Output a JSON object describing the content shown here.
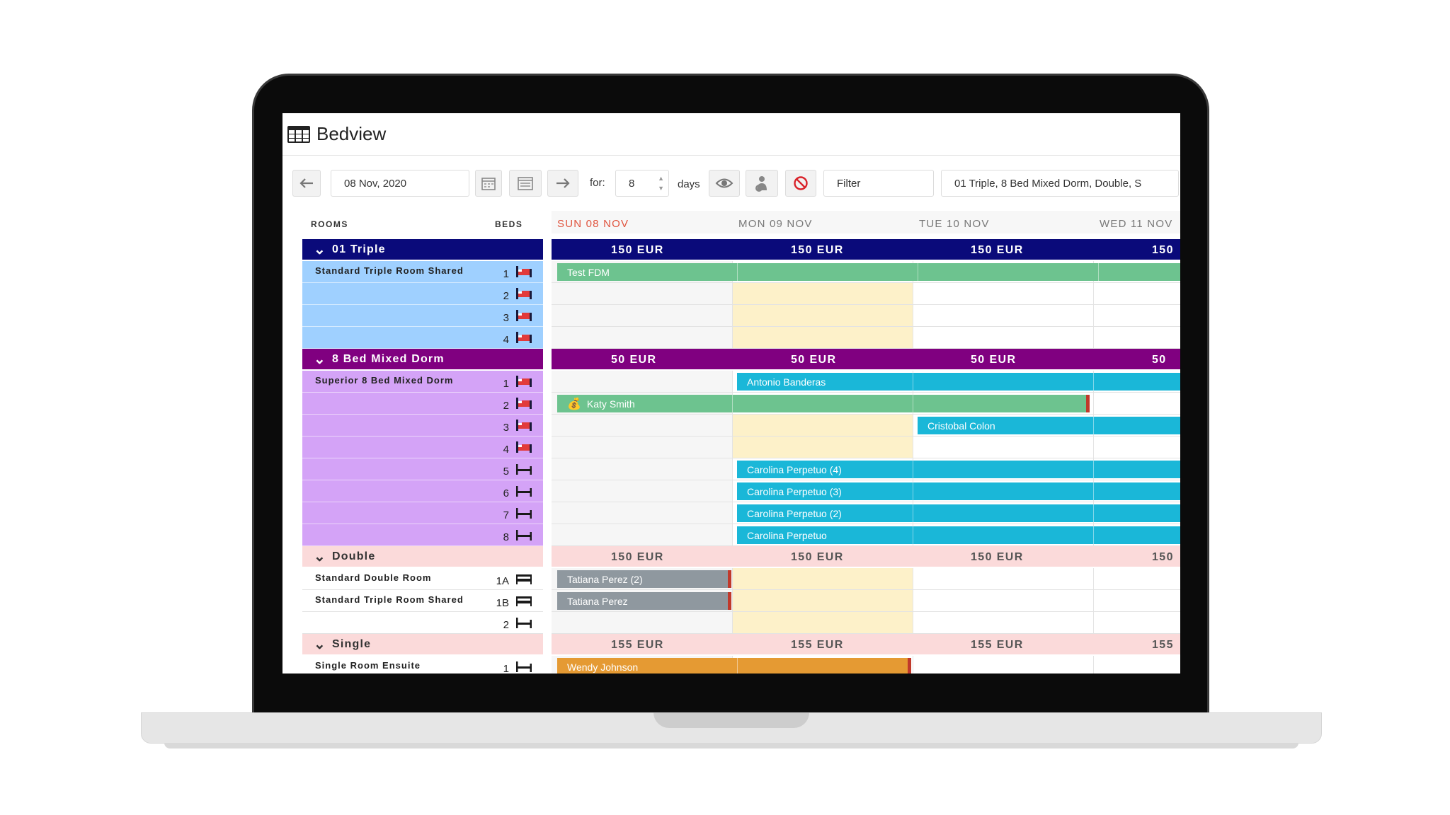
{
  "app": {
    "title": "Bedview"
  },
  "toolbar": {
    "date_value": "08 Nov, 2020",
    "for_label": "for:",
    "days_value": "8",
    "days_label": "days",
    "filter_placeholder": "Filter",
    "room_select_value": "01 Triple, 8 Bed Mixed Dorm, Double, S"
  },
  "columns": {
    "rooms": "ROOMS",
    "beds": "BEDS"
  },
  "days": [
    "SUN 08 NOV",
    "MON 09 NOV",
    "TUE 10 NOV",
    "WED 11 NOV"
  ],
  "colors": {
    "triple_header": "#0a0a7a",
    "triple_rows": "#9fd0ff",
    "dorm_header": "#800080",
    "dorm_rows": "#d4a3f7",
    "pink_header": "#fbdada",
    "today": "#e0533d"
  },
  "categories": {
    "triple": {
      "name": "01 Triple",
      "prices": [
        "150 EUR",
        "150 EUR",
        "150 EUR",
        "150"
      ]
    },
    "dorm": {
      "name": "8 Bed Mixed Dorm",
      "prices": [
        "50 EUR",
        "50 EUR",
        "50 EUR",
        "50"
      ]
    },
    "double": {
      "name": "Double",
      "prices": [
        "150 EUR",
        "150 EUR",
        "150 EUR",
        "150"
      ]
    },
    "single": {
      "name": "Single",
      "prices": [
        "155 EUR",
        "155 EUR",
        "155 EUR",
        "155"
      ]
    }
  },
  "rooms": {
    "triple_room": "Standard Triple Room Shared",
    "dorm_room": "Superior 8 Bed Mixed Dorm",
    "double_room_a": "Standard Double Room",
    "double_room_b": "Standard Triple Room Shared",
    "single_room": "Single Room Ensuite"
  },
  "beds": {
    "triple": [
      "1",
      "2",
      "3",
      "4"
    ],
    "dorm": [
      "1",
      "2",
      "3",
      "4",
      "5",
      "6",
      "7",
      "8"
    ],
    "double": [
      "1A",
      "1B",
      "2"
    ],
    "single": [
      "1"
    ]
  },
  "bookings": {
    "test_fdm": "Test FDM",
    "antonio": "Antonio Banderas",
    "katy": "Katy Smith",
    "cristobal": "Cristobal Colon",
    "carolina4": "Carolina Perpetuo (4)",
    "carolina3": "Carolina Perpetuo (3)",
    "carolina2": "Carolina Perpetuo (2)",
    "carolina": "Carolina Perpetuo",
    "tatiana2": "Tatiana Perez (2)",
    "tatiana": "Tatiana Perez",
    "wendy": "Wendy Johnson"
  },
  "icons": {
    "header": "table-grid-icon",
    "prev": "arrow-left-icon",
    "next": "arrow-right-icon",
    "cal1": "calendar-icon",
    "cal2": "calendar-grid-icon",
    "eye": "eye-icon",
    "person": "person-icon",
    "block": "no-entry-icon",
    "bed": "bed-icon",
    "money": "money-bag-icon"
  }
}
